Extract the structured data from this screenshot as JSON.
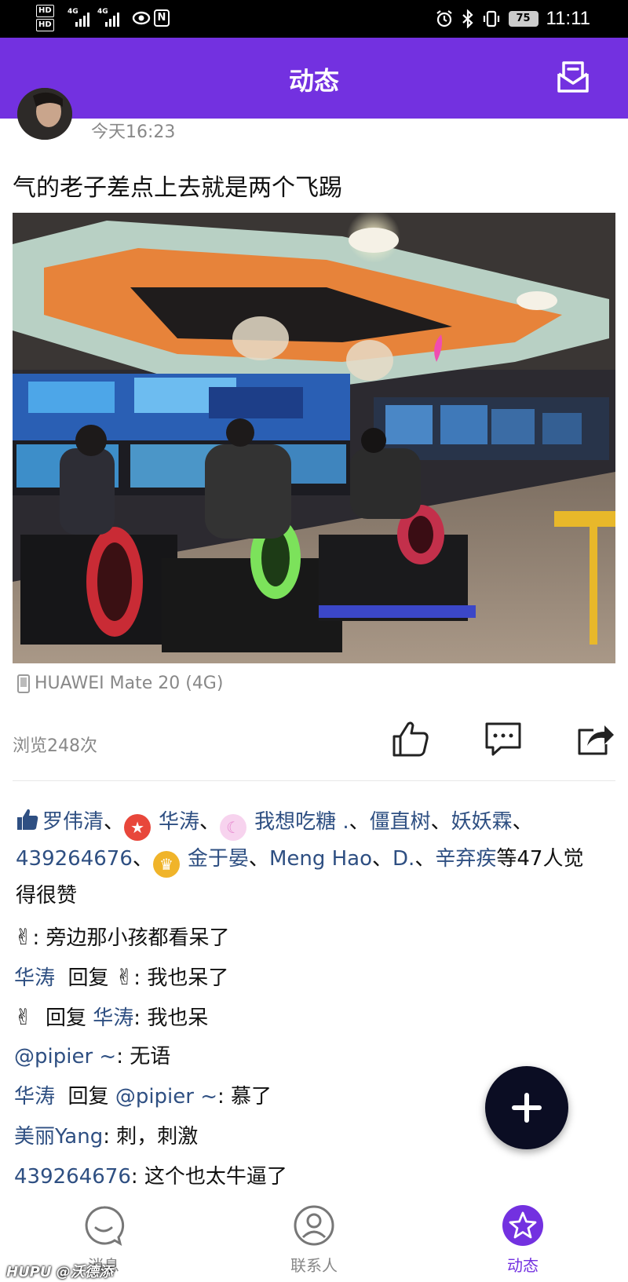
{
  "status_bar": {
    "hd1": "HD",
    "hd2": "HD",
    "net1": "4G",
    "net2": "4G",
    "battery": "75",
    "time": "11:11"
  },
  "header": {
    "title": "动态",
    "mail_icon": "envelope-icon"
  },
  "post": {
    "time": "今天16:23",
    "text": "气的老子差点上去就是两个飞踢",
    "device": "HUAWEI Mate 20 (4G)",
    "views": "浏览248次"
  },
  "likes": {
    "names": [
      "罗伟清",
      "华涛",
      "我想吃糖 .",
      "僵直树",
      "妖妖霖",
      "439264676",
      "金于晏",
      "Meng Hao",
      "D.",
      "辛弃疾"
    ],
    "suffix_a": "等47人觉",
    "suffix_b": "得很赞",
    "sep": "、"
  },
  "comments": [
    {
      "who": "✌",
      "reply_to": "",
      "text": ": 旁边那小孩都看呆了"
    },
    {
      "who": "华涛",
      "reply_word": "回复",
      "reply_to": "✌",
      "text": ": 我也呆了"
    },
    {
      "who": "✌",
      "reply_word": "回复",
      "reply_to": "华涛",
      "text": ": 我也呆"
    },
    {
      "who": "@pipier ~",
      "reply_to": "",
      "text": ": 无语"
    },
    {
      "who": "华涛",
      "reply_word": "回复",
      "reply_to": "@pipier ~",
      "text": ": 慕了"
    },
    {
      "who": "美丽Yang",
      "reply_to": "",
      "text": ": 刺，刺激"
    },
    {
      "who": "439264676",
      "reply_to": "",
      "text": ": 这个也太牛逼了"
    }
  ],
  "nav": {
    "messages": "消息",
    "contacts": "联系人",
    "moments": "动态"
  },
  "watermark": "HUPU @沃德添",
  "colors": {
    "brand": "#7331e0",
    "link": "#2e4f82",
    "fab": "#0b0d23"
  }
}
